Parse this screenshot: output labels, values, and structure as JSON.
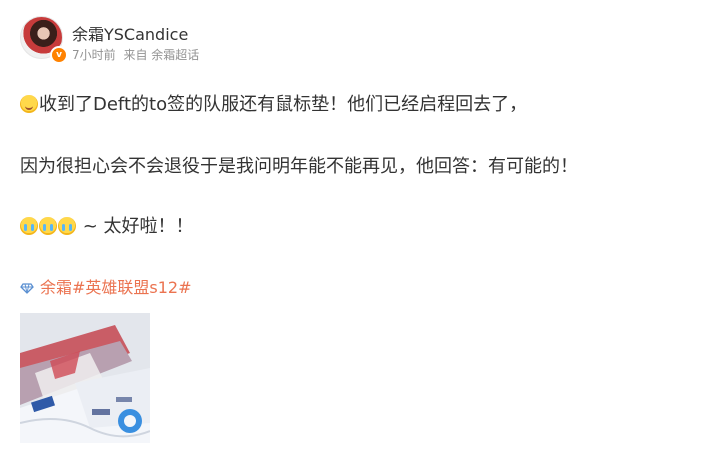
{
  "user": {
    "name": "余霜YSCandice",
    "time": "7小时前",
    "source": "来自 余霜超话",
    "verified_badge": "v"
  },
  "post": {
    "line1": "收到了Deft的to签的队服还有鼠标垫！他们已经启程回去了，",
    "line2": "因为很担心会不会退役于是我问明年能不能再见，他回答：有可能的！",
    "line3": "~ 太好啦！！"
  },
  "topic": {
    "icon": "diamond-icon",
    "label": "余霜#英雄联盟s12#"
  },
  "colors": {
    "link": "#eb7350",
    "meta": "#939393",
    "text": "#333333",
    "badge": "#ff8200"
  }
}
